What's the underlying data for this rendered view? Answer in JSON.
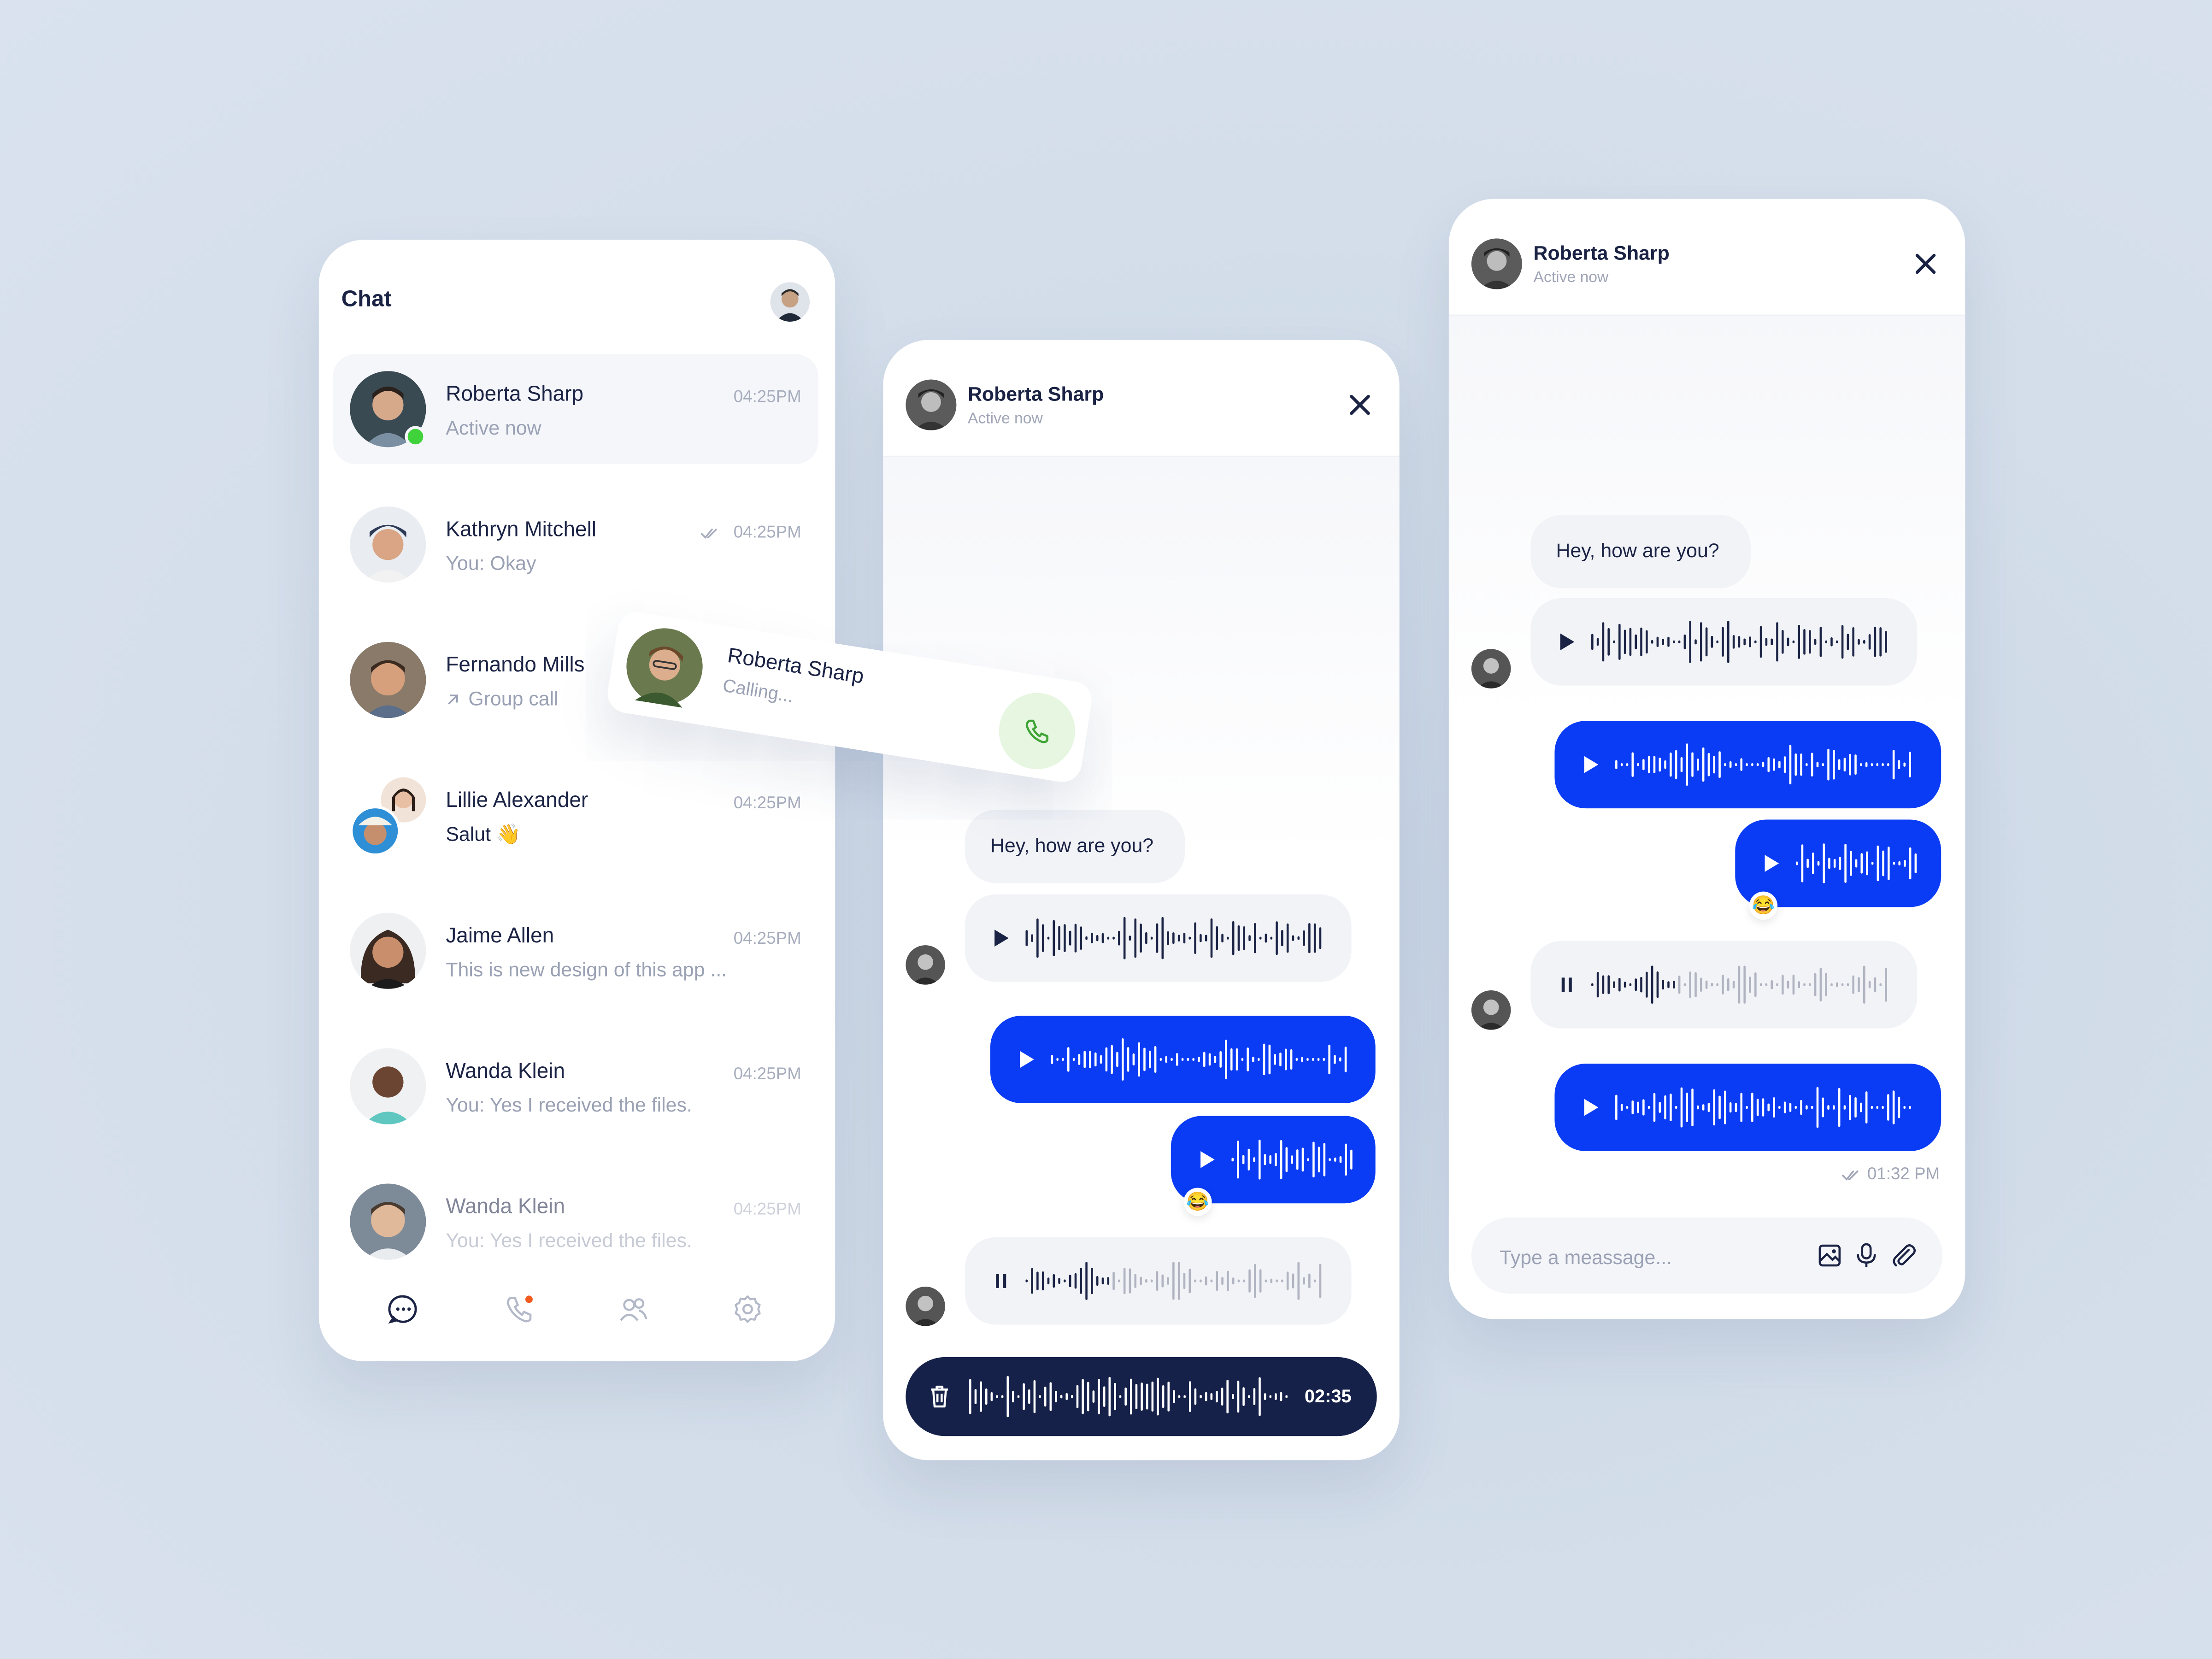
{
  "list": {
    "title": "Chat",
    "conversations": [
      {
        "name": "Roberta Sharp",
        "sub": "Active now",
        "time": "04:25PM",
        "active": true
      },
      {
        "name": "Kathryn Mitchell",
        "sub": "You: Okay",
        "time": "04:25PM",
        "read": true
      },
      {
        "name": "Fernando Mills",
        "sub": "Group call",
        "time": ""
      },
      {
        "name": "Lillie Alexander",
        "sub": "Salut 👋",
        "time": "04:25PM"
      },
      {
        "name": "Jaime Allen",
        "sub": "This is new design of this app ...",
        "time": "04:25PM"
      },
      {
        "name": "Wanda Klein",
        "sub": "You: Yes I received the files.",
        "time": "04:25PM"
      },
      {
        "name": "Wanda Klein",
        "sub": "You: Yes I received the files.",
        "time": "04:25PM"
      }
    ],
    "nav": [
      "chat-icon",
      "phone-icon",
      "contacts-icon",
      "settings-icon"
    ]
  },
  "call": {
    "name": "Roberta Sharp",
    "status": "Calling..."
  },
  "chat_mid": {
    "name": "Roberta Sharp",
    "status": "Active now",
    "greeting": "Hey, how are you?",
    "reaction": "😂",
    "record_time": "02:35"
  },
  "chat_right": {
    "name": "Roberta Sharp",
    "status": "Active now",
    "greeting": "Hey, how are you?",
    "reaction": "😂",
    "sent_time": "01:32 PM",
    "input_placeholder": "Type a meassage..."
  },
  "colors": {
    "accent": "#0A3CF5",
    "dark": "#152149",
    "online": "#3FD23A",
    "call_green": "#3FA535"
  }
}
